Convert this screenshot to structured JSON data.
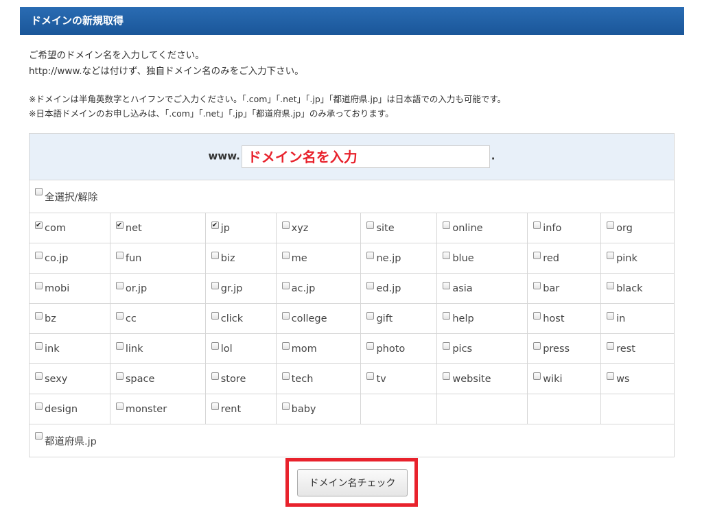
{
  "header": {
    "title": "ドメインの新規取得"
  },
  "intro": {
    "line1": "ご希望のドメイン名を入力してください。",
    "line2": "http://www.などは付けず、独自ドメイン名のみをご入力下さい。"
  },
  "notes": {
    "line1": "※ドメインは半角英数字とハイフンでご入力ください。「.com」「.net」「.jp」「都道府県.jp」は日本語での入力も可能です。",
    "line2": "※日本語ドメインのお申し込みは、「.com」「.net」「.jp」「都道府県.jp」のみ承っております。"
  },
  "domain_input": {
    "prefix": "www.",
    "placeholder": "ドメイン名を入力",
    "suffix": ".",
    "value": ""
  },
  "select_all": {
    "label": "全選択/解除",
    "checked": false
  },
  "tlds": [
    [
      {
        "label": "com",
        "checked": true
      },
      {
        "label": "net",
        "checked": true
      },
      {
        "label": "jp",
        "checked": true
      },
      {
        "label": "xyz",
        "checked": false
      },
      {
        "label": "site",
        "checked": false
      },
      {
        "label": "online",
        "checked": false
      },
      {
        "label": "info",
        "checked": false
      },
      {
        "label": "org",
        "checked": false
      }
    ],
    [
      {
        "label": "co.jp",
        "checked": false
      },
      {
        "label": "fun",
        "checked": false
      },
      {
        "label": "biz",
        "checked": false
      },
      {
        "label": "me",
        "checked": false
      },
      {
        "label": "ne.jp",
        "checked": false
      },
      {
        "label": "blue",
        "checked": false
      },
      {
        "label": "red",
        "checked": false
      },
      {
        "label": "pink",
        "checked": false
      }
    ],
    [
      {
        "label": "mobi",
        "checked": false
      },
      {
        "label": "or.jp",
        "checked": false
      },
      {
        "label": "gr.jp",
        "checked": false
      },
      {
        "label": "ac.jp",
        "checked": false
      },
      {
        "label": "ed.jp",
        "checked": false
      },
      {
        "label": "asia",
        "checked": false
      },
      {
        "label": "bar",
        "checked": false
      },
      {
        "label": "black",
        "checked": false
      }
    ],
    [
      {
        "label": "bz",
        "checked": false
      },
      {
        "label": "cc",
        "checked": false
      },
      {
        "label": "click",
        "checked": false
      },
      {
        "label": "college",
        "checked": false
      },
      {
        "label": "gift",
        "checked": false
      },
      {
        "label": "help",
        "checked": false
      },
      {
        "label": "host",
        "checked": false
      },
      {
        "label": "in",
        "checked": false
      }
    ],
    [
      {
        "label": "ink",
        "checked": false
      },
      {
        "label": "link",
        "checked": false
      },
      {
        "label": "lol",
        "checked": false
      },
      {
        "label": "mom",
        "checked": false
      },
      {
        "label": "photo",
        "checked": false
      },
      {
        "label": "pics",
        "checked": false
      },
      {
        "label": "press",
        "checked": false
      },
      {
        "label": "rest",
        "checked": false
      }
    ],
    [
      {
        "label": "sexy",
        "checked": false
      },
      {
        "label": "space",
        "checked": false
      },
      {
        "label": "store",
        "checked": false
      },
      {
        "label": "tech",
        "checked": false
      },
      {
        "label": "tv",
        "checked": false
      },
      {
        "label": "website",
        "checked": false
      },
      {
        "label": "wiki",
        "checked": false
      },
      {
        "label": "ws",
        "checked": false
      }
    ],
    [
      {
        "label": "design",
        "checked": false
      },
      {
        "label": "monster",
        "checked": false
      },
      {
        "label": "rent",
        "checked": false
      },
      {
        "label": "baby",
        "checked": false
      }
    ]
  ],
  "prefecture": {
    "label": "都道府県.jp",
    "checked": false
  },
  "check_button": {
    "label": "ドメイン名チェック"
  },
  "colors": {
    "header_bg": "#1f5fa3",
    "input_row_bg": "#e8f0f9",
    "highlight_border": "#e8222c",
    "placeholder_text": "#e8222c"
  }
}
